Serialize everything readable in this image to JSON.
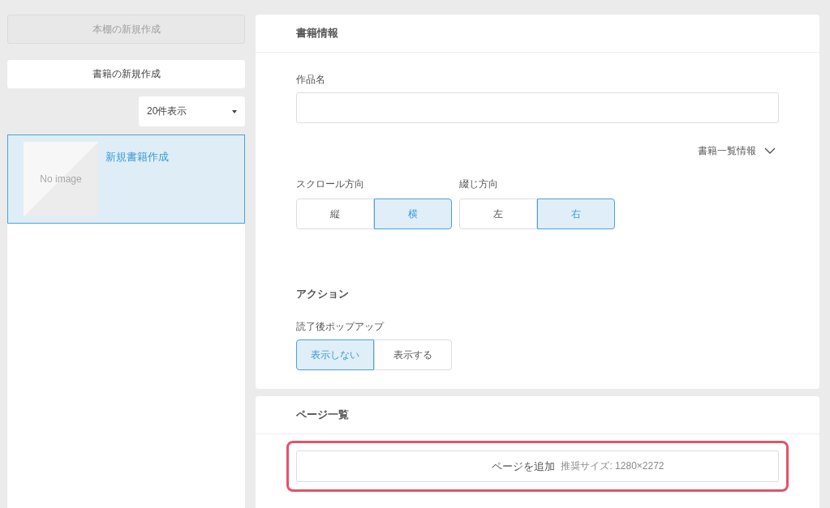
{
  "sidebar": {
    "new_shelf_button": {
      "label": "本棚の新規作成",
      "disabled": true
    },
    "new_book_button": {
      "label": "書籍の新規作成",
      "disabled": false
    },
    "page_size_select": {
      "value": "20件表示"
    },
    "books": [
      {
        "title": "新規書籍作成",
        "thumbnail_text": "No image",
        "selected": true
      }
    ]
  },
  "book_info": {
    "title": "書籍情報",
    "work_name_field": {
      "label": "作品名"
    },
    "list_info_toggle": {
      "label": "書籍一覧情報",
      "expanded": false
    },
    "direction_groups": [
      {
        "label": "スクロール方向",
        "options": [
          {
            "label": "縦",
            "selected": false
          },
          {
            "label": "横",
            "selected": true
          }
        ]
      },
      {
        "label": "綴じ方向",
        "options": [
          {
            "label": "左",
            "selected": false
          },
          {
            "label": "右",
            "selected": true
          }
        ]
      }
    ],
    "action_section": {
      "title": "アクション",
      "groups": [
        {
          "label": "読了後ポップアップ",
          "options": [
            {
              "label": "表示しない",
              "selected": true
            },
            {
              "label": "表示する",
              "selected": false
            }
          ]
        }
      ]
    }
  },
  "pages": {
    "title": "ページ一覧",
    "add_button": {
      "label": "ページを追加",
      "hint": "推奨サイズ: 1280×2272",
      "highlighted": true
    }
  }
}
